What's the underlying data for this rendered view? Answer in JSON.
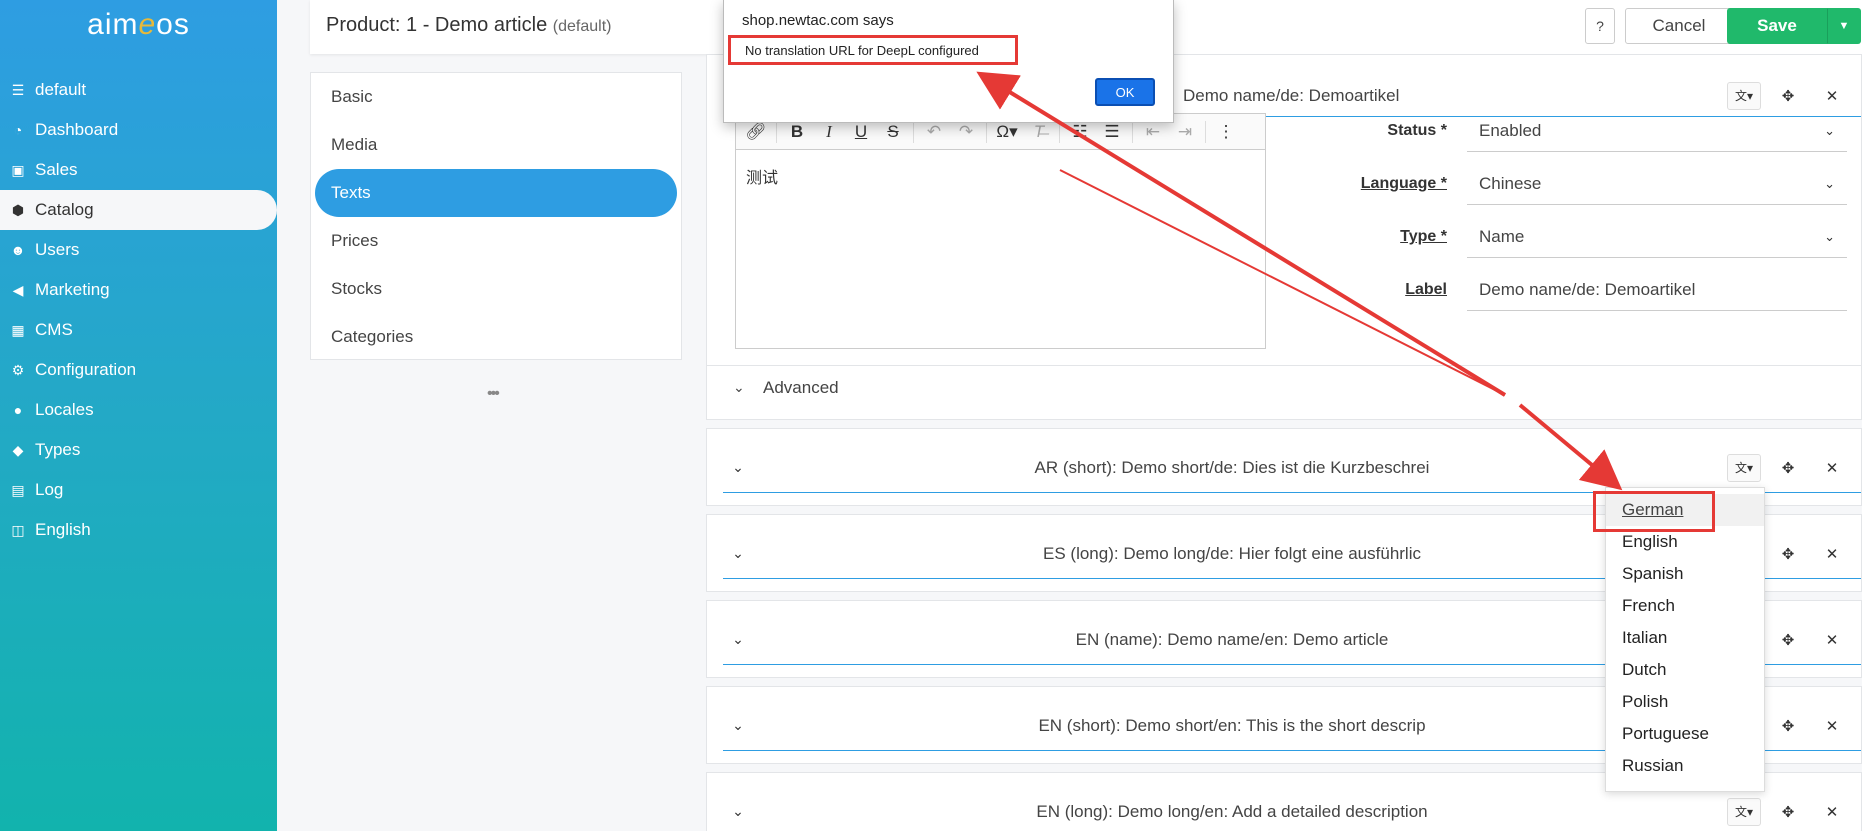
{
  "brand": {
    "logo_text_a": "aim",
    "logo_text_e": "e",
    "logo_text_b": "os"
  },
  "sidebar": {
    "items": [
      {
        "label": "default",
        "icon": "list-icon"
      },
      {
        "label": "Dashboard",
        "icon": "dashboard-icon"
      },
      {
        "label": "Sales",
        "icon": "money-icon"
      },
      {
        "label": "Catalog",
        "icon": "cubes-icon"
      },
      {
        "label": "Users",
        "icon": "users-icon"
      },
      {
        "label": "Marketing",
        "icon": "megaphone-icon"
      },
      {
        "label": "CMS",
        "icon": "grid-icon"
      },
      {
        "label": "Configuration",
        "icon": "gears-icon"
      },
      {
        "label": "Locales",
        "icon": "globe-icon"
      },
      {
        "label": "Types",
        "icon": "tag-icon"
      },
      {
        "label": "Log",
        "icon": "archive-icon"
      },
      {
        "label": "English",
        "icon": "language-icon"
      }
    ]
  },
  "header": {
    "title": "Product: 1 - Demo article",
    "title_suffix": "(default)",
    "help_label": "?",
    "cancel_label": "Cancel",
    "save_label": "Save"
  },
  "tabs": [
    "Basic",
    "Media",
    "Texts",
    "Prices",
    "Stocks",
    "Categories"
  ],
  "tabs_more": "•••",
  "dialog": {
    "origin": "shop.newtac.com says",
    "message": "No translation URL for DeepL configured",
    "ok_label": "OK"
  },
  "card1": {
    "title": "Demo name/de: Demoartikel",
    "editor_content": "测试",
    "fields": {
      "status": {
        "label": "Status *",
        "value": "Enabled"
      },
      "language": {
        "label": "Language *",
        "value": "Chinese"
      },
      "type": {
        "label": "Type *",
        "value": "Name"
      },
      "label": {
        "label": "Label",
        "value": "Demo name/de: Demoartikel"
      }
    },
    "advanced_label": "Advanced"
  },
  "cards": [
    {
      "title": "AR (short): Demo short/de: Dies ist die Kurzbeschrei"
    },
    {
      "title": "ES (long): Demo long/de: Hier folgt eine ausführlic"
    },
    {
      "title": "EN (name): Demo name/en: Demo article"
    },
    {
      "title": "EN (short): Demo short/en: This is the short descrip"
    },
    {
      "title": "EN (long): Demo long/en: Add a detailed description"
    }
  ],
  "lang_menu": [
    "German",
    "English",
    "Spanish",
    "French",
    "Italian",
    "Dutch",
    "Polish",
    "Portuguese",
    "Russian"
  ],
  "colors": {
    "accent": "#2e9de2",
    "save": "#20b96b",
    "annotation": "#e53935"
  }
}
